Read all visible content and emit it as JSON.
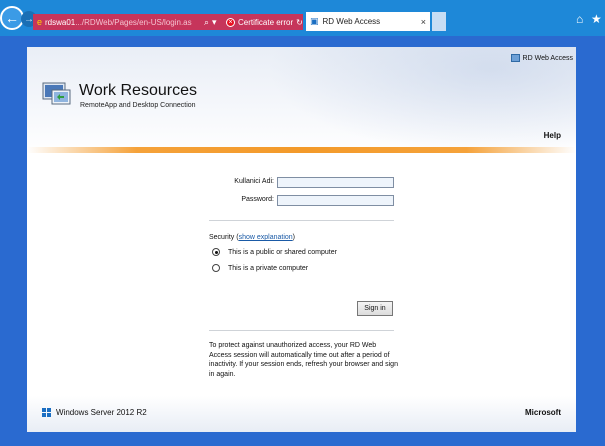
{
  "browser": {
    "address_host": "rdswa01",
    "address_path": ".../RDWeb/Pages/en-US/login.as",
    "search_icon": "⌕",
    "dropdown_icon": "▾",
    "certificate_error": "Certificate error",
    "refresh_icon": "↻",
    "tab_title": "RD Web Access",
    "tab_close": "×",
    "home_icon": "⌂",
    "star_icon": "★",
    "back_icon": "←",
    "forward_icon": "→"
  },
  "header": {
    "rd_web_access": "RD Web Access",
    "title": "Work Resources",
    "subtitle": "RemoteApp and Desktop Connection",
    "help": "Help"
  },
  "form": {
    "username_label": "Kullanici Adi:",
    "password_label": "Password:",
    "username_value": "",
    "password_value": "",
    "security_prefix": "Security (",
    "security_link": "show explanation",
    "security_suffix": ")",
    "option_public": "This is a public or shared computer",
    "option_private": "This is a private computer",
    "selected_option": "public",
    "sign_in": "Sign in",
    "timeout_note": "To protect against unauthorized access, your RD Web Access session will automatically time out after a period of inactivity. If your session ends, refresh your browser and sign in again."
  },
  "footer": {
    "os_name": "Windows Server 2012 R2",
    "vendor": "Microsoft"
  },
  "colors": {
    "chrome_blue": "#1e88d8",
    "cert_error_pink": "#c6355b",
    "accent_orange": "#f39a2a",
    "link_blue": "#1a5aa6"
  }
}
